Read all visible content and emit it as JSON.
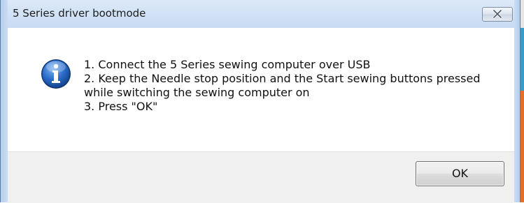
{
  "window": {
    "title": "5 Series driver bootmode"
  },
  "message": {
    "lines": [
      "1. Connect the 5 Series sewing computer over USB",
      "2. Keep the Needle stop position and the Start sewing buttons pressed",
      "while switching the sewing computer on",
      "3. Press \"OK\""
    ]
  },
  "icon": "info-icon",
  "buttons": {
    "ok_label": "OK",
    "close_icon": "close-icon"
  },
  "colors": {
    "title_bar": "#c8dbf3",
    "footer": "#f0f0f0",
    "info_icon_blue": "#1f5fb8"
  }
}
